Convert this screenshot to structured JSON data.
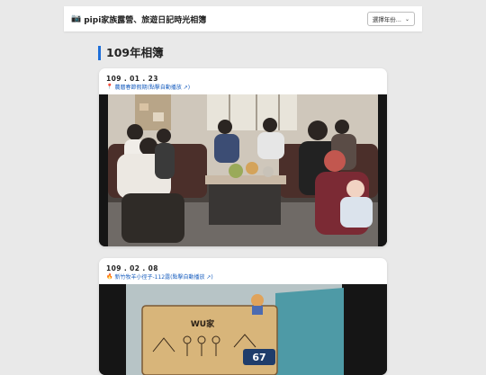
{
  "header": {
    "camera_icon": "camera-icon",
    "title": "pipi家族露營、旅遊日記時光相簿",
    "year_select": {
      "label": "選擇年份...",
      "icon": "chevron-down-icon"
    }
  },
  "section": {
    "title": "109年相簿"
  },
  "albums": [
    {
      "date": "109 . 01 . 23",
      "location_icon": "pin-icon",
      "location": "農曆春節假期(點擊自動播放 ↗)"
    },
    {
      "date": "109 . 02 . 08",
      "location_icon": "campfire-icon",
      "location": "新竹牧羊小徑子-112露(點擊自動播放 ↗)"
    }
  ],
  "photo2": {
    "sign_text": "WU家",
    "plate_number": "67"
  }
}
